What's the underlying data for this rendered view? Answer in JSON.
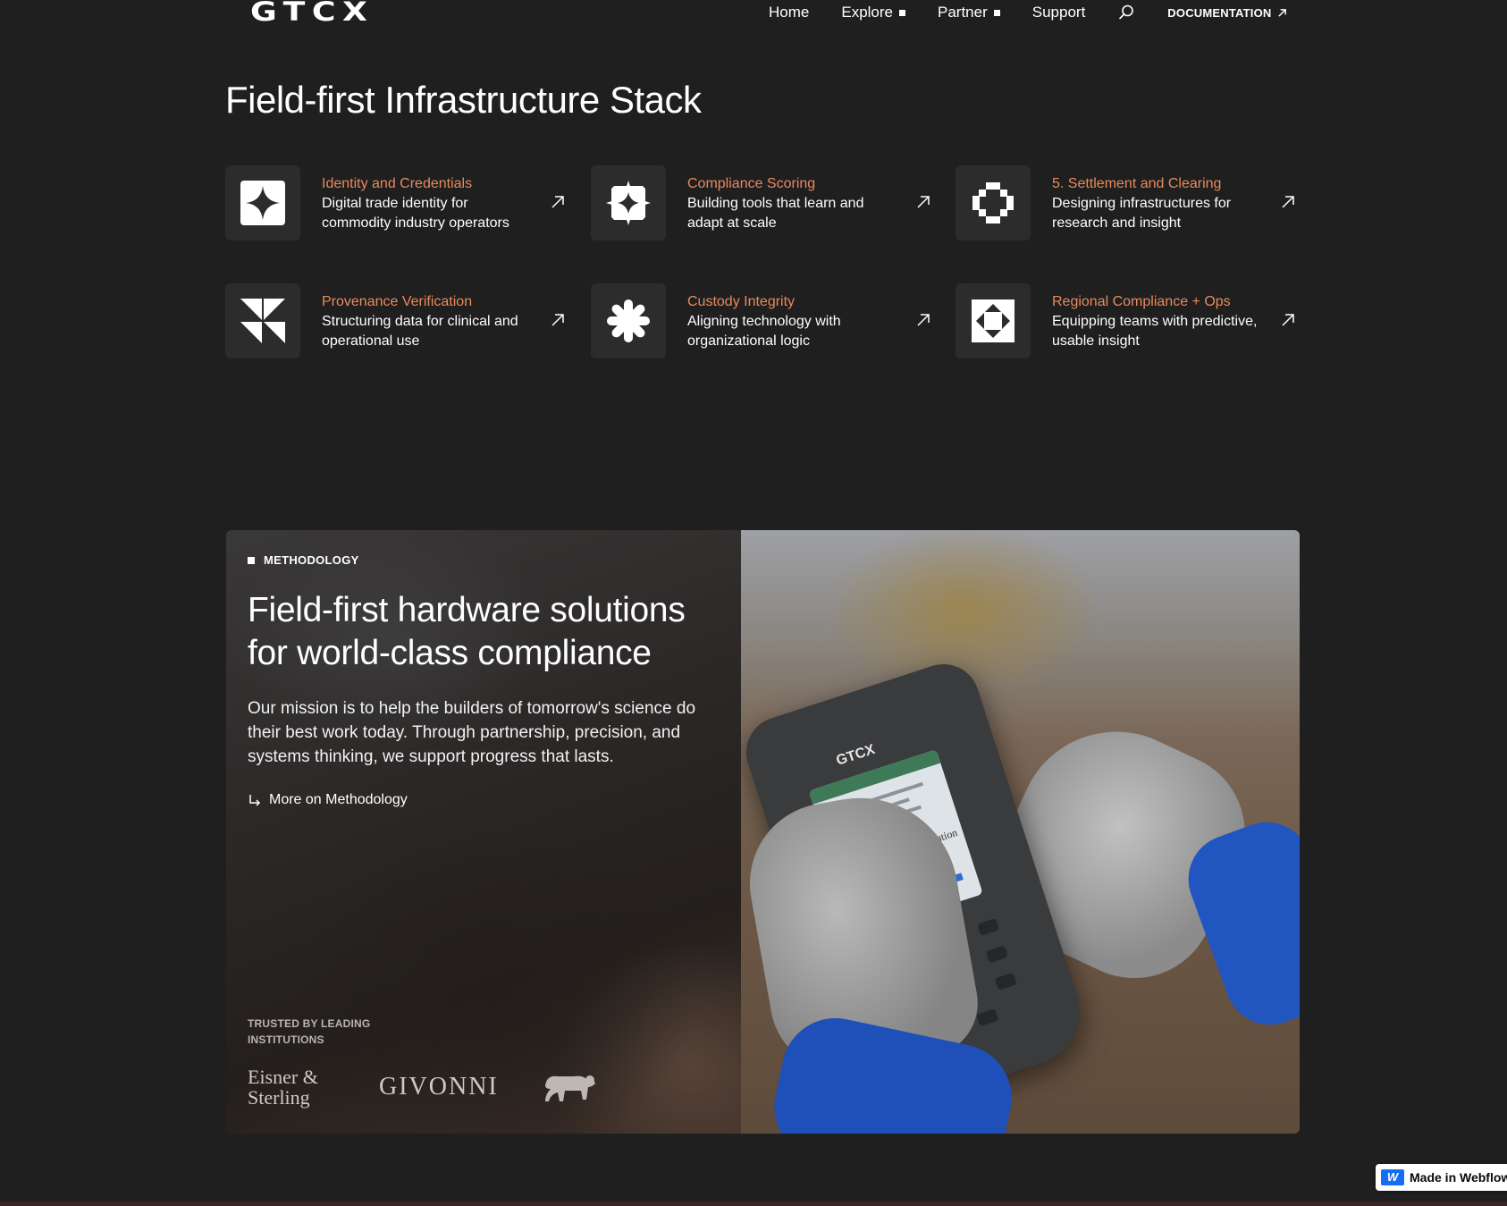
{
  "brand": {
    "logo_text": "GTCX"
  },
  "nav": {
    "links": [
      {
        "label": "Home",
        "has_marker": false
      },
      {
        "label": "Explore",
        "has_marker": true
      },
      {
        "label": "Partner",
        "has_marker": true
      },
      {
        "label": "Support",
        "has_marker": false
      }
    ],
    "search_icon": "search-icon",
    "documentation_label": "DOCUMENTATION"
  },
  "stack": {
    "title": "Field-first Infrastructure Stack",
    "accent_color": "#e98a5c",
    "cards": [
      {
        "title": "Identity and Credentials",
        "description": "Digital trade identity for commodity industry operators",
        "icon": "four-point-star-icon"
      },
      {
        "title": "Compliance Scoring",
        "description": "Building tools that learn and adapt at scale",
        "icon": "concave-diamond-icon"
      },
      {
        "title": "5. Settlement and Clearing",
        "description": "Designing infrastructures for research and insight",
        "icon": "pixel-ring-icon"
      },
      {
        "title": "Provenance Verification",
        "description": "Structuring data for clinical and operational use",
        "icon": "triangles-icon"
      },
      {
        "title": "Custody Integrity",
        "description": "Aligning technology with organizational logic",
        "icon": "asterisk-icon"
      },
      {
        "title": "Regional Compliance + Ops",
        "description": "Equipping teams with predictive, usable insight",
        "icon": "diamond-in-square-icon"
      }
    ]
  },
  "methodology": {
    "kicker": "METHODOLOGY",
    "headline": "Field-first hardware solutions for world-class compliance",
    "mission": "Our mission is to help the builders of tomorrow's science do their best work today. Through partnership, precision, and systems thinking, we support progress that lasts.",
    "more_link": "More on Methodology",
    "trusted_label": "TRUSTED BY LEADING INSTITUTIONS",
    "partner_logos": [
      "Eisner & Sterling",
      "GIVONNI",
      "monkey-logo"
    ],
    "image": {
      "device_brand": "GTCX",
      "screen_caption": "Compliance Confirmation",
      "icon": "handheld-device-photo"
    }
  },
  "badge": {
    "label": "Made in Webflow"
  }
}
